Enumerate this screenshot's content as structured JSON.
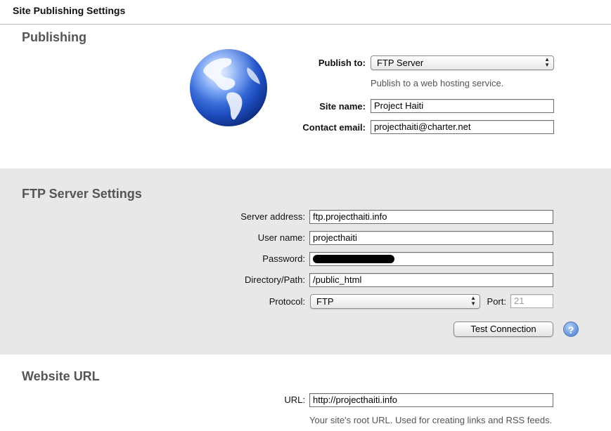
{
  "window": {
    "title": "Site Publishing Settings"
  },
  "publishing": {
    "heading": "Publishing",
    "publish_to_label": "Publish to:",
    "publish_to_value": "FTP Server",
    "publish_hint": "Publish to a web hosting service.",
    "site_name_label": "Site name:",
    "site_name_value": "Project Haiti",
    "contact_email_label": "Contact email:",
    "contact_email_value": "projecthaiti@charter.net",
    "globe_icon": "globe-icon"
  },
  "ftp": {
    "heading": "FTP Server Settings",
    "server_address_label": "Server address:",
    "server_address_value": "ftp.projecthaiti.info",
    "user_name_label": "User name:",
    "user_name_value": "projecthaiti",
    "password_label": "Password:",
    "directory_label": "Directory/Path:",
    "directory_value": "/public_html",
    "protocol_label": "Protocol:",
    "protocol_value": "FTP",
    "port_label": "Port:",
    "port_value": "21",
    "test_connection_label": "Test Connection",
    "help_icon": "help-icon"
  },
  "website_url": {
    "heading": "Website URL",
    "url_label": "URL:",
    "url_value": "http://projecthaiti.info",
    "url_hint": "Your site's root URL. Used for creating links and RSS feeds."
  },
  "colors": {
    "ftp_section_bg": "#e8e8e8",
    "heading_text": "#555555",
    "help_blue": "#5f8fd8"
  }
}
